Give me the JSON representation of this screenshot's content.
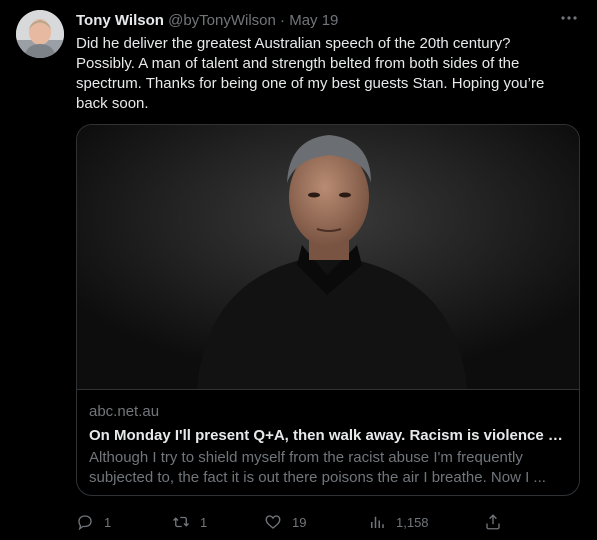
{
  "tweet": {
    "author_name": "Tony Wilson",
    "author_handle": "@byTonyWilson",
    "separator": "·",
    "date": "May 19",
    "text": "Did he deliver the greatest Australian speech of the 20th century? Possibly. A man of talent and strength belted from both sides of the spectrum. Thanks for being one of my best guests Stan. Hoping you’re back soon."
  },
  "card": {
    "domain": "abc.net.au",
    "title": "On Monday I'll present Q+A, then walk away. Racism is violence and ...",
    "description": "Although I try to shield myself from the racist abuse I'm frequently subjected to, the fact it is out there poisons the air I breathe. Now I ..."
  },
  "actions": {
    "replies": "1",
    "retweets": "1",
    "likes": "19",
    "views": "1,158"
  },
  "icons": {
    "more": "more-icon",
    "reply": "reply-icon",
    "retweet": "retweet-icon",
    "like": "heart-icon",
    "views": "views-icon",
    "share": "share-icon"
  },
  "colors": {
    "background": "#000000",
    "text": "#e7e9ea",
    "secondary": "#71767b",
    "border": "#2f3336"
  }
}
